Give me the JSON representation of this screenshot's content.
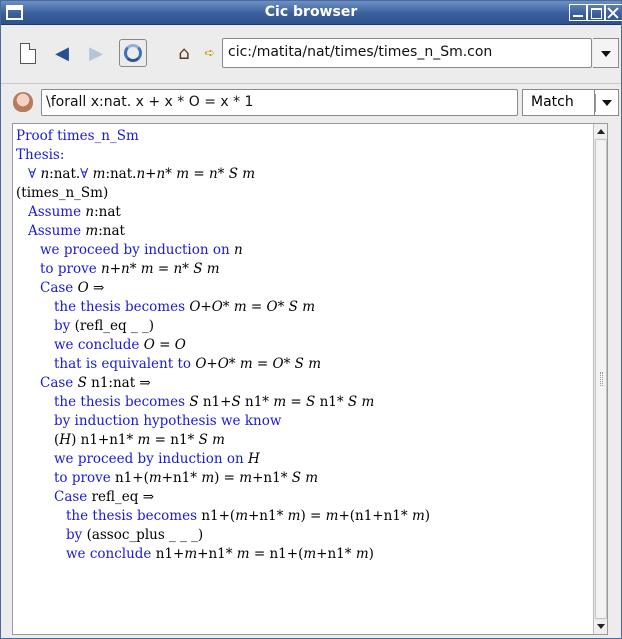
{
  "window": {
    "title": "Cic browser"
  },
  "toolbar": {
    "icons": [
      "new-page-icon",
      "back-arrow-icon",
      "forward-arrow-icon",
      "refresh-icon",
      "home-icon",
      "goto-icon"
    ],
    "url": "cic:/matita/nat/times/times_n_Sm.con"
  },
  "search": {
    "query": "\\forall x:nat. x + x * O = x * 1",
    "match_option": "Match"
  },
  "proof": {
    "lines": [
      {
        "indent": "d1",
        "parts": [
          {
            "t": "Proof times_n_Sm",
            "c": "kw"
          }
        ]
      },
      {
        "indent": "d1",
        "parts": [
          {
            "t": "Thesis:",
            "c": "kw"
          }
        ]
      },
      {
        "indent": "i1",
        "parts": [
          {
            "t": "∀ ",
            "c": "kw"
          },
          {
            "t": "n",
            "c": "m"
          },
          {
            "t": ":nat.",
            "c": ""
          },
          {
            "t": "∀ ",
            "c": "kw"
          },
          {
            "t": "m",
            "c": "m"
          },
          {
            "t": ":nat.",
            "c": ""
          },
          {
            "t": "n",
            "c": "m"
          },
          {
            "t": "+",
            "c": ""
          },
          {
            "t": "n",
            "c": "m"
          },
          {
            "t": "* ",
            "c": ""
          },
          {
            "t": "m",
            "c": "m"
          },
          {
            "t": " = ",
            "c": ""
          },
          {
            "t": "n",
            "c": "m"
          },
          {
            "t": "* ",
            "c": ""
          },
          {
            "t": "S m",
            "c": "m"
          }
        ]
      },
      {
        "indent": "d1",
        "parts": [
          {
            "t": "(times_n_Sm)",
            "c": ""
          }
        ]
      },
      {
        "indent": "i1",
        "parts": [
          {
            "t": "Assume ",
            "c": "kw"
          },
          {
            "t": "n",
            "c": "m"
          },
          {
            "t": ":nat",
            "c": ""
          }
        ]
      },
      {
        "indent": "i1",
        "parts": [
          {
            "t": "Assume ",
            "c": "kw"
          },
          {
            "t": "m",
            "c": "m"
          },
          {
            "t": ":nat",
            "c": ""
          }
        ]
      },
      {
        "indent": "i2",
        "parts": [
          {
            "t": "we proceed by induction on ",
            "c": "kw"
          },
          {
            "t": "n",
            "c": "m"
          }
        ]
      },
      {
        "indent": "i2",
        "parts": [
          {
            "t": "to prove ",
            "c": "kw"
          },
          {
            "t": "n",
            "c": "m"
          },
          {
            "t": "+",
            "c": ""
          },
          {
            "t": "n",
            "c": "m"
          },
          {
            "t": "* ",
            "c": ""
          },
          {
            "t": "m",
            "c": "m"
          },
          {
            "t": " = ",
            "c": ""
          },
          {
            "t": "n",
            "c": "m"
          },
          {
            "t": "* ",
            "c": ""
          },
          {
            "t": "S m",
            "c": "m"
          }
        ]
      },
      {
        "indent": "i2",
        "parts": [
          {
            "t": "Case ",
            "c": "kw"
          },
          {
            "t": "O",
            "c": "m"
          },
          {
            "t": " ⇒",
            "c": ""
          }
        ]
      },
      {
        "indent": "i3",
        "parts": [
          {
            "t": "the thesis becomes ",
            "c": "kw"
          },
          {
            "t": "O",
            "c": "m"
          },
          {
            "t": "+",
            "c": ""
          },
          {
            "t": "O",
            "c": "m"
          },
          {
            "t": "* ",
            "c": ""
          },
          {
            "t": "m",
            "c": "m"
          },
          {
            "t": " = ",
            "c": ""
          },
          {
            "t": "O",
            "c": "m"
          },
          {
            "t": "* ",
            "c": ""
          },
          {
            "t": "S m",
            "c": "m"
          }
        ]
      },
      {
        "indent": "i3",
        "parts": [
          {
            "t": "by ",
            "c": "kw"
          },
          {
            "t": "(refl_eq  _  _)",
            "c": ""
          }
        ]
      },
      {
        "indent": "i3",
        "parts": [
          {
            "t": "we conclude ",
            "c": "kw"
          },
          {
            "t": "O",
            "c": "m"
          },
          {
            "t": " = ",
            "c": ""
          },
          {
            "t": "O",
            "c": "m"
          }
        ]
      },
      {
        "indent": "i3",
        "parts": [
          {
            "t": "that is equivalent to ",
            "c": "kw"
          },
          {
            "t": "O",
            "c": "m"
          },
          {
            "t": "+",
            "c": ""
          },
          {
            "t": "O",
            "c": "m"
          },
          {
            "t": "* ",
            "c": ""
          },
          {
            "t": "m",
            "c": "m"
          },
          {
            "t": " = ",
            "c": ""
          },
          {
            "t": "O",
            "c": "m"
          },
          {
            "t": "* ",
            "c": ""
          },
          {
            "t": "S m",
            "c": "m"
          }
        ]
      },
      {
        "indent": "i2",
        "parts": [
          {
            "t": "Case ",
            "c": "kw"
          },
          {
            "t": "S",
            "c": "m"
          },
          {
            "t": " n1:nat ⇒",
            "c": ""
          }
        ]
      },
      {
        "indent": "i3",
        "parts": [
          {
            "t": "the thesis becomes ",
            "c": "kw"
          },
          {
            "t": "S",
            "c": "m"
          },
          {
            "t": " n1+",
            "c": ""
          },
          {
            "t": "S",
            "c": "m"
          },
          {
            "t": " n1* ",
            "c": ""
          },
          {
            "t": "m",
            "c": "m"
          },
          {
            "t": " = ",
            "c": ""
          },
          {
            "t": "S",
            "c": "m"
          },
          {
            "t": " n1* ",
            "c": ""
          },
          {
            "t": "S m",
            "c": "m"
          }
        ]
      },
      {
        "indent": "i3",
        "parts": [
          {
            "t": "by induction hypothesis we know",
            "c": "kw"
          }
        ]
      },
      {
        "indent": "i3",
        "parts": [
          {
            "t": "(",
            "c": ""
          },
          {
            "t": "H",
            "c": "m"
          },
          {
            "t": ") n1+n1* ",
            "c": ""
          },
          {
            "t": "m",
            "c": "m"
          },
          {
            "t": " = n1* ",
            "c": ""
          },
          {
            "t": "S m",
            "c": "m"
          }
        ]
      },
      {
        "indent": "i3",
        "parts": [
          {
            "t": "we proceed by induction on ",
            "c": "kw"
          },
          {
            "t": "H",
            "c": "m"
          }
        ]
      },
      {
        "indent": "i3",
        "parts": [
          {
            "t": "to prove ",
            "c": "kw"
          },
          {
            "t": "n1+(",
            "c": ""
          },
          {
            "t": "m",
            "c": "m"
          },
          {
            "t": "+n1* ",
            "c": ""
          },
          {
            "t": "m",
            "c": "m"
          },
          {
            "t": ") = ",
            "c": ""
          },
          {
            "t": "m",
            "c": "m"
          },
          {
            "t": "+n1* ",
            "c": ""
          },
          {
            "t": "S m",
            "c": "m"
          }
        ]
      },
      {
        "indent": "i3",
        "parts": [
          {
            "t": "Case ",
            "c": "kw"
          },
          {
            "t": "refl_eq ⇒",
            "c": ""
          }
        ]
      },
      {
        "indent": "i4",
        "parts": [
          {
            "t": "the thesis becomes ",
            "c": "kw"
          },
          {
            "t": "n1+(",
            "c": ""
          },
          {
            "t": "m",
            "c": "m"
          },
          {
            "t": "+n1* ",
            "c": ""
          },
          {
            "t": "m",
            "c": "m"
          },
          {
            "t": ") = ",
            "c": ""
          },
          {
            "t": "m",
            "c": "m"
          },
          {
            "t": "+(n1+n1* ",
            "c": ""
          },
          {
            "t": "m",
            "c": "m"
          },
          {
            "t": ")",
            "c": ""
          }
        ]
      },
      {
        "indent": "i4",
        "parts": [
          {
            "t": "by ",
            "c": "kw"
          },
          {
            "t": "(assoc_plus  _  _  _)",
            "c": ""
          }
        ]
      },
      {
        "indent": "i4",
        "parts": [
          {
            "t": "we conclude ",
            "c": "kw"
          },
          {
            "t": "n1+",
            "c": ""
          },
          {
            "t": "m",
            "c": "m"
          },
          {
            "t": "+n1* ",
            "c": ""
          },
          {
            "t": "m",
            "c": "m"
          },
          {
            "t": " = n1+(",
            "c": ""
          },
          {
            "t": "m",
            "c": "m"
          },
          {
            "t": "+n1* ",
            "c": ""
          },
          {
            "t": "m",
            "c": "m"
          },
          {
            "t": ")",
            "c": ""
          }
        ]
      }
    ]
  },
  "colors": {
    "keyword": "#1a1ad8",
    "titlebar": "#3a5f9c"
  }
}
